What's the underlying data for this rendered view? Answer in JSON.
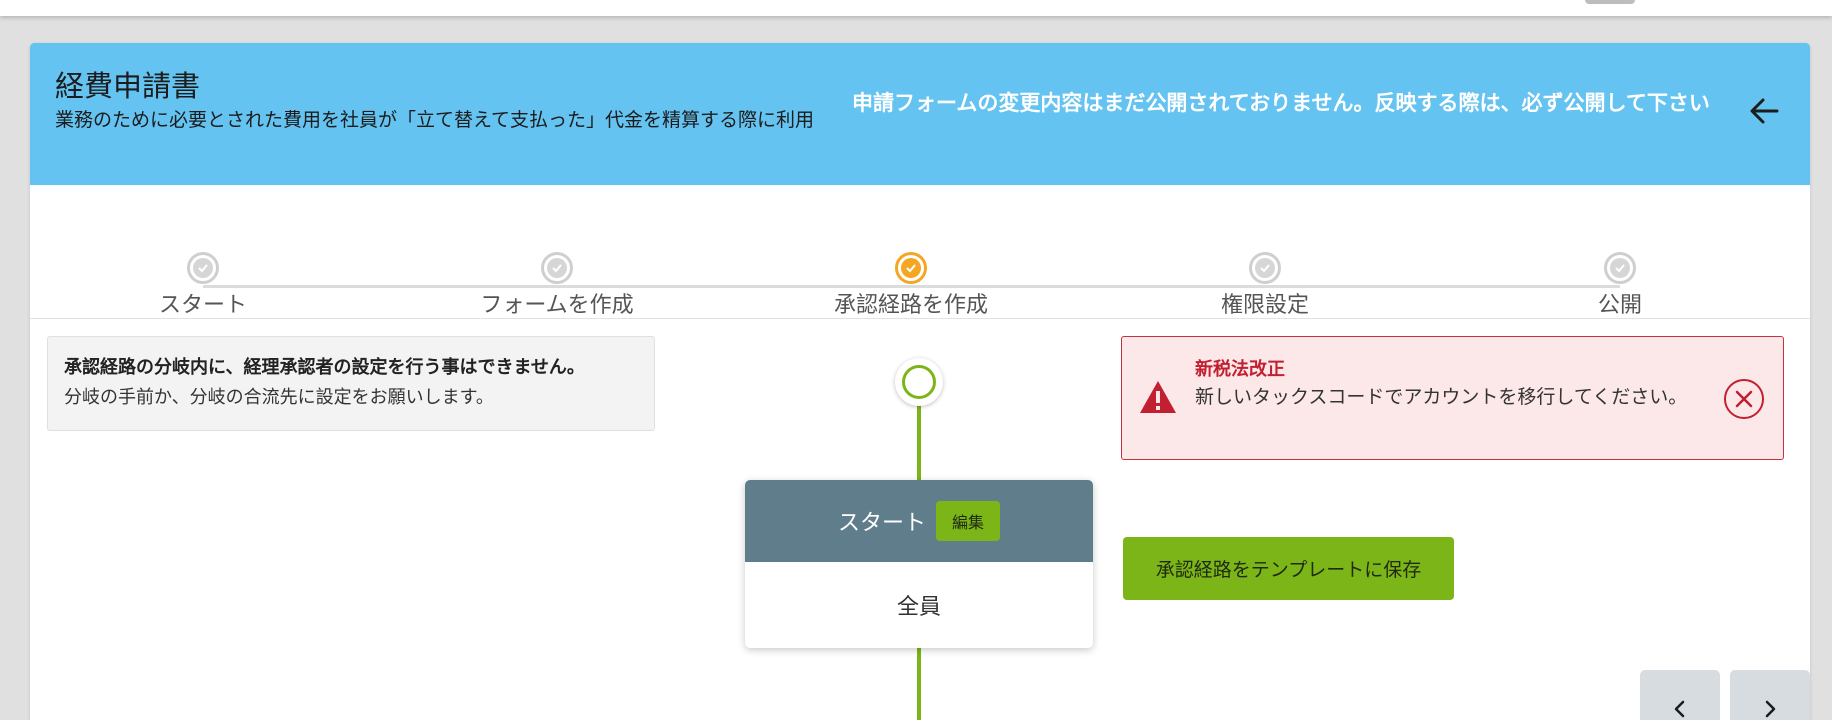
{
  "header": {
    "title": "経費申請書",
    "description": "業務のために必要とされた費用を社員が「立て替えて支払った」代金を精算する際に利用",
    "notice": "申請フォームの変更内容はまだ公開されておりません。反映する際は、必ず公開して下さい"
  },
  "stepper": {
    "steps": [
      {
        "label": "スタート"
      },
      {
        "label": "フォームを作成"
      },
      {
        "label": "承認経路を作成"
      },
      {
        "label": "権限設定"
      },
      {
        "label": "公開"
      }
    ],
    "active_step": "承認経路を作成"
  },
  "info": {
    "bold": "承認経路の分岐内に、経理承認者の設定を行う事はできません。",
    "text": "分岐の手前か、分岐の合流先に設定をお願いします。"
  },
  "alert": {
    "title": "新税法改正",
    "text": "新しいタックスコードでアカウントを移行してください。"
  },
  "flow": {
    "node_title": "スタート",
    "edit_label": "編集",
    "node_body": "全員"
  },
  "actions": {
    "save_template_label": "承認経路をテンプレートに保存"
  },
  "colors": {
    "header_bg": "#64c3f1",
    "accent_green": "#7cb518",
    "active_step": "#f5a623",
    "alert_red": "#c21f30",
    "node_header": "#607d8b"
  }
}
